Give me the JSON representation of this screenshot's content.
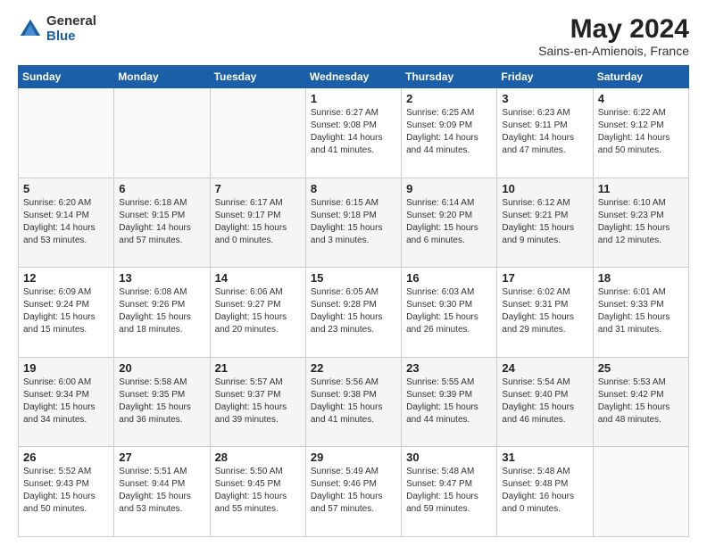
{
  "logo": {
    "general": "General",
    "blue": "Blue"
  },
  "title": {
    "month_year": "May 2024",
    "location": "Sains-en-Amienois, France"
  },
  "headers": [
    "Sunday",
    "Monday",
    "Tuesday",
    "Wednesday",
    "Thursday",
    "Friday",
    "Saturday"
  ],
  "rows": [
    [
      {
        "day": "",
        "info": ""
      },
      {
        "day": "",
        "info": ""
      },
      {
        "day": "",
        "info": ""
      },
      {
        "day": "1",
        "info": "Sunrise: 6:27 AM\nSunset: 9:08 PM\nDaylight: 14 hours\nand 41 minutes."
      },
      {
        "day": "2",
        "info": "Sunrise: 6:25 AM\nSunset: 9:09 PM\nDaylight: 14 hours\nand 44 minutes."
      },
      {
        "day": "3",
        "info": "Sunrise: 6:23 AM\nSunset: 9:11 PM\nDaylight: 14 hours\nand 47 minutes."
      },
      {
        "day": "4",
        "info": "Sunrise: 6:22 AM\nSunset: 9:12 PM\nDaylight: 14 hours\nand 50 minutes."
      }
    ],
    [
      {
        "day": "5",
        "info": "Sunrise: 6:20 AM\nSunset: 9:14 PM\nDaylight: 14 hours\nand 53 minutes."
      },
      {
        "day": "6",
        "info": "Sunrise: 6:18 AM\nSunset: 9:15 PM\nDaylight: 14 hours\nand 57 minutes."
      },
      {
        "day": "7",
        "info": "Sunrise: 6:17 AM\nSunset: 9:17 PM\nDaylight: 15 hours\nand 0 minutes."
      },
      {
        "day": "8",
        "info": "Sunrise: 6:15 AM\nSunset: 9:18 PM\nDaylight: 15 hours\nand 3 minutes."
      },
      {
        "day": "9",
        "info": "Sunrise: 6:14 AM\nSunset: 9:20 PM\nDaylight: 15 hours\nand 6 minutes."
      },
      {
        "day": "10",
        "info": "Sunrise: 6:12 AM\nSunset: 9:21 PM\nDaylight: 15 hours\nand 9 minutes."
      },
      {
        "day": "11",
        "info": "Sunrise: 6:10 AM\nSunset: 9:23 PM\nDaylight: 15 hours\nand 12 minutes."
      }
    ],
    [
      {
        "day": "12",
        "info": "Sunrise: 6:09 AM\nSunset: 9:24 PM\nDaylight: 15 hours\nand 15 minutes."
      },
      {
        "day": "13",
        "info": "Sunrise: 6:08 AM\nSunset: 9:26 PM\nDaylight: 15 hours\nand 18 minutes."
      },
      {
        "day": "14",
        "info": "Sunrise: 6:06 AM\nSunset: 9:27 PM\nDaylight: 15 hours\nand 20 minutes."
      },
      {
        "day": "15",
        "info": "Sunrise: 6:05 AM\nSunset: 9:28 PM\nDaylight: 15 hours\nand 23 minutes."
      },
      {
        "day": "16",
        "info": "Sunrise: 6:03 AM\nSunset: 9:30 PM\nDaylight: 15 hours\nand 26 minutes."
      },
      {
        "day": "17",
        "info": "Sunrise: 6:02 AM\nSunset: 9:31 PM\nDaylight: 15 hours\nand 29 minutes."
      },
      {
        "day": "18",
        "info": "Sunrise: 6:01 AM\nSunset: 9:33 PM\nDaylight: 15 hours\nand 31 minutes."
      }
    ],
    [
      {
        "day": "19",
        "info": "Sunrise: 6:00 AM\nSunset: 9:34 PM\nDaylight: 15 hours\nand 34 minutes."
      },
      {
        "day": "20",
        "info": "Sunrise: 5:58 AM\nSunset: 9:35 PM\nDaylight: 15 hours\nand 36 minutes."
      },
      {
        "day": "21",
        "info": "Sunrise: 5:57 AM\nSunset: 9:37 PM\nDaylight: 15 hours\nand 39 minutes."
      },
      {
        "day": "22",
        "info": "Sunrise: 5:56 AM\nSunset: 9:38 PM\nDaylight: 15 hours\nand 41 minutes."
      },
      {
        "day": "23",
        "info": "Sunrise: 5:55 AM\nSunset: 9:39 PM\nDaylight: 15 hours\nand 44 minutes."
      },
      {
        "day": "24",
        "info": "Sunrise: 5:54 AM\nSunset: 9:40 PM\nDaylight: 15 hours\nand 46 minutes."
      },
      {
        "day": "25",
        "info": "Sunrise: 5:53 AM\nSunset: 9:42 PM\nDaylight: 15 hours\nand 48 minutes."
      }
    ],
    [
      {
        "day": "26",
        "info": "Sunrise: 5:52 AM\nSunset: 9:43 PM\nDaylight: 15 hours\nand 50 minutes."
      },
      {
        "day": "27",
        "info": "Sunrise: 5:51 AM\nSunset: 9:44 PM\nDaylight: 15 hours\nand 53 minutes."
      },
      {
        "day": "28",
        "info": "Sunrise: 5:50 AM\nSunset: 9:45 PM\nDaylight: 15 hours\nand 55 minutes."
      },
      {
        "day": "29",
        "info": "Sunrise: 5:49 AM\nSunset: 9:46 PM\nDaylight: 15 hours\nand 57 minutes."
      },
      {
        "day": "30",
        "info": "Sunrise: 5:48 AM\nSunset: 9:47 PM\nDaylight: 15 hours\nand 59 minutes."
      },
      {
        "day": "31",
        "info": "Sunrise: 5:48 AM\nSunset: 9:48 PM\nDaylight: 16 hours\nand 0 minutes."
      },
      {
        "day": "",
        "info": ""
      }
    ]
  ]
}
